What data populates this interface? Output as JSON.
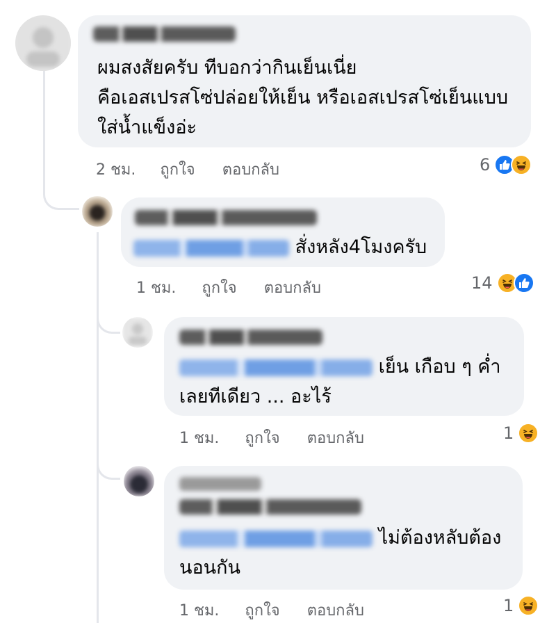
{
  "comments": [
    {
      "text_lines": [
        "ผมสงสัยครับ ทีบอกว่ากินเย็นเนี่ย",
        "คือเอสเปรสโซ่ปล่อยให้เย็น หรือเอสเปรสโซ่เย็นแบบ",
        "ใส่น้ำแข็งอ่ะ"
      ],
      "time": "2 ชม.",
      "like_label": "ถูกใจ",
      "reply_label": "ตอบกลับ",
      "reaction_count": "6",
      "reactions": [
        "like-icon",
        "haha-icon"
      ]
    },
    {
      "text": "สั่งหลัง4โมงครับ",
      "time": "1 ชม.",
      "like_label": "ถูกใจ",
      "reply_label": "ตอบกลับ",
      "reaction_count": "14",
      "reactions": [
        "haha-icon",
        "like-icon"
      ]
    },
    {
      "text_lines": [
        "เย็น เกือบ ๆ ค่ำ",
        "เลยทีเดียว ... อะไร้"
      ],
      "time": "1 ชม.",
      "like_label": "ถูกใจ",
      "reply_label": "ตอบกลับ",
      "reaction_count": "1",
      "reactions": [
        "haha-icon"
      ]
    },
    {
      "text_lines": [
        "ไม่ต้องหลับต้อง",
        "นอนกัน"
      ],
      "time": "1 ชม.",
      "like_label": "ถูกใจ",
      "reply_label": "ตอบกลับ",
      "reaction_count": "1",
      "reactions": [
        "haha-icon"
      ]
    }
  ],
  "colors": {
    "bubble": "#f0f2f5",
    "meta_text": "#65676b",
    "like_blue": "#1877f2",
    "haha_yellow": "#f7b125",
    "thread_line": "#e4e6eb"
  }
}
